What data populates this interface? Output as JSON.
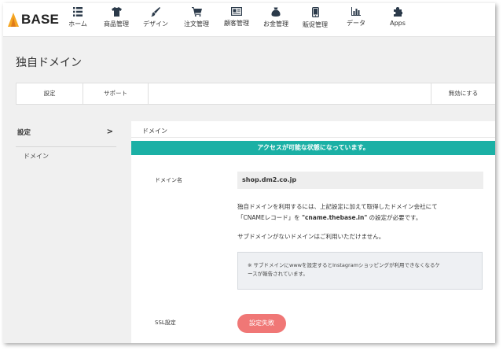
{
  "app": {
    "logo_text": "BASE"
  },
  "nav": [
    {
      "label": "ホーム",
      "icon": "grid-icon"
    },
    {
      "label": "商品管理",
      "icon": "tshirt-icon"
    },
    {
      "label": "デザイン",
      "icon": "brush-icon"
    },
    {
      "label": "注文管理",
      "icon": "cart-icon"
    },
    {
      "label": "顧客管理",
      "icon": "address-card-icon"
    },
    {
      "label": "お金管理",
      "icon": "money-bag-icon"
    },
    {
      "label": "販促管理",
      "icon": "smartphone-icon"
    },
    {
      "label": "データ",
      "icon": "bar-chart-icon"
    },
    {
      "label": "Apps",
      "icon": "puzzle-icon"
    }
  ],
  "page": {
    "title": "独自ドメイン"
  },
  "tabs": [
    {
      "label": "設定"
    },
    {
      "label": "サポート"
    }
  ],
  "tabs_right": {
    "label": "無効にする"
  },
  "sidebar": {
    "heading": "設定",
    "items": [
      {
        "label": "ドメイン"
      }
    ]
  },
  "panel": {
    "title": "ドメイン",
    "alert": "アクセスが可能な状態になっています。",
    "domain_label": "ドメイン名",
    "domain_value": "shop.dm2.co.jp",
    "desc_line1": "独自ドメインを利用するには、上記設定に加えて取得したドメイン会社にて",
    "desc_line2_pre": "「CNAMEレコード」を ",
    "desc_line2_bold": "\"cname.thebase.in\"",
    "desc_line2_post": " の設定が必要です。",
    "desc_line3": "サブドメインがないドメインはご利用いただけません。",
    "note_line1": "※ サブドメインにwwwを設定するとInstagramショッピングが利用できなくなるケ",
    "note_line2": "ースが報告されています。",
    "ssl_label": "SSL設定",
    "ssl_button": "設定失敗"
  },
  "colors": {
    "alert": "#1bb0a5",
    "ssl_button": "#f07776",
    "logo_accent": "#f5a623"
  }
}
